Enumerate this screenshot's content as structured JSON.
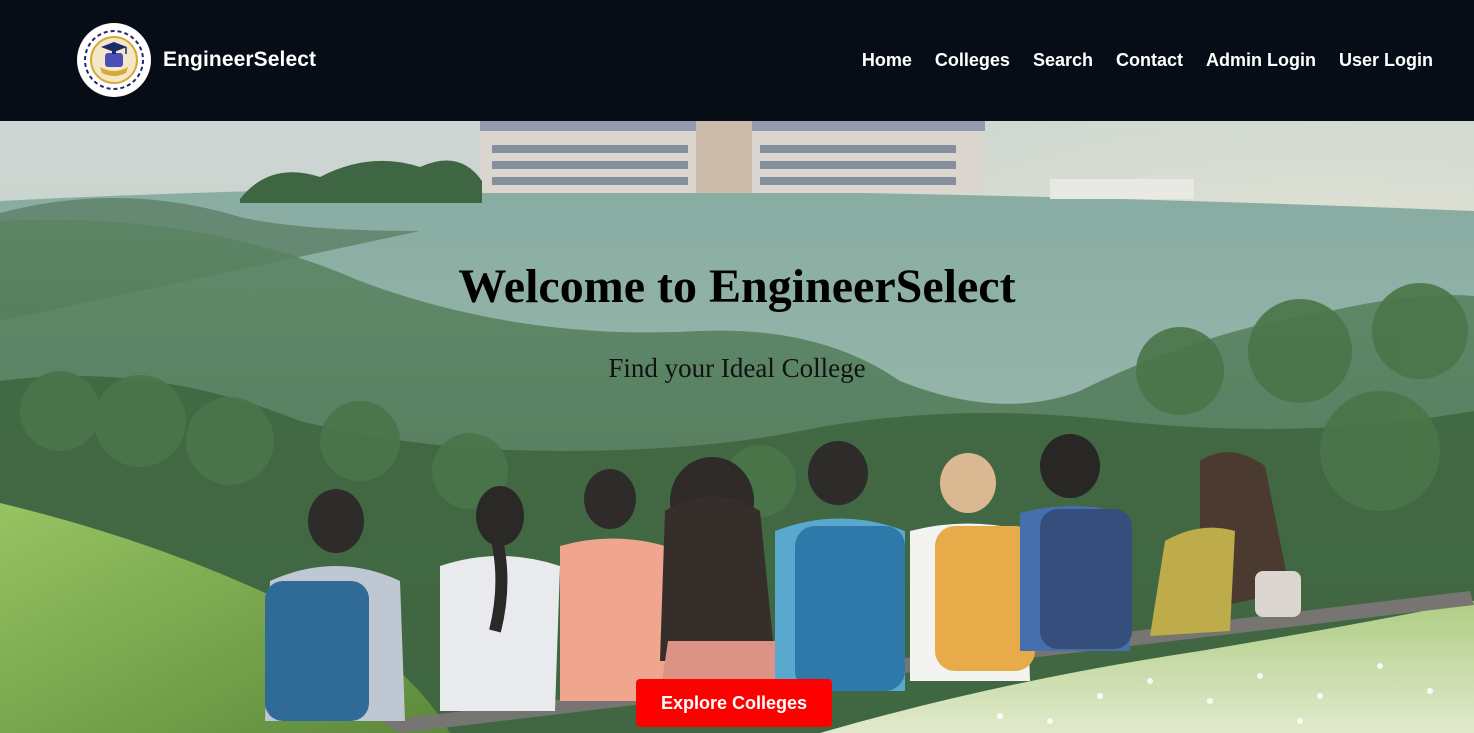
{
  "brand": {
    "name": "EngineerSelect"
  },
  "nav": {
    "items": [
      {
        "label": "Home"
      },
      {
        "label": "Colleges"
      },
      {
        "label": "Search"
      },
      {
        "label": "Contact"
      },
      {
        "label": "Admin Login"
      },
      {
        "label": "User Login"
      }
    ]
  },
  "hero": {
    "title": "Welcome to EngineerSelect",
    "subtitle": "Find your Ideal College",
    "cta_label": "Explore Colleges"
  },
  "colors": {
    "header_bg": "#070d17",
    "cta_bg": "#ff0000",
    "text_light": "#ffffff"
  }
}
